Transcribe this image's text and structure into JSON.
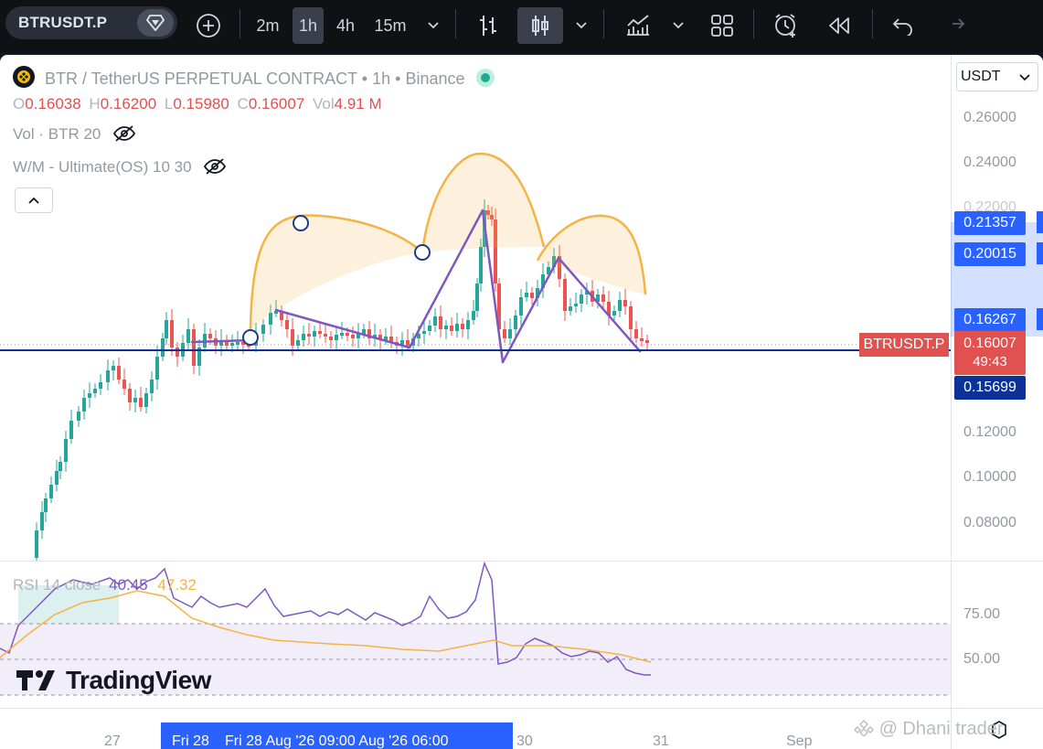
{
  "toolbar": {
    "symbol": "BTRUSDT.P",
    "intervals": [
      "2m",
      "1h",
      "4h",
      "15m"
    ],
    "active_interval": "1h"
  },
  "legend": {
    "title": "BTR / TetherUS PERPETUAL CONTRACT",
    "sep1": "•",
    "interval": "1h",
    "sep2": "•",
    "exchange": "Binance",
    "open_key": "O",
    "open": "0.16038",
    "high_key": "H",
    "high": "0.16200",
    "low_key": "L",
    "low": "0.15980",
    "close_key": "C",
    "close": "0.16007",
    "vol_key": "Vol",
    "vol": "4.91 M",
    "indicator_vol": "Vol · BTR 20",
    "indicator_wm": "W/M - Ultimate(OS) 10 30"
  },
  "currency": "USDT",
  "price_ticks": [
    "0.26000",
    "0.24000",
    "0.22000",
    "0.12000",
    "0.10000",
    "0.08000"
  ],
  "price_labels": [
    {
      "value": "0.21357",
      "color": "#2962ff"
    },
    {
      "value": "0.20015",
      "color": "#2962ff"
    },
    {
      "value": "0.16267",
      "color": "#2962ff"
    },
    {
      "value": "0.16007",
      "color": "#e0514f"
    },
    {
      "value": "0.15699",
      "color": "#0c3299"
    }
  ],
  "countdown": "49:43",
  "symbol_tag": "BTRUSDT.P",
  "rsi": {
    "label": "RSI 14 close",
    "value": "40.45",
    "ma": "47.32",
    "ticks": [
      "75.00",
      "50.00"
    ]
  },
  "time_axis": {
    "labels": [
      "27",
      "30",
      "31",
      "Sep"
    ],
    "highlight_left": "Fri 28",
    "highlight_right": "Fri 28 Aug '26   09:00   Aug '26   06:00"
  },
  "branding": {
    "logo_text": "TradingView",
    "watermark": "@ Dhani trader"
  },
  "colors": {
    "up": "#26a69a",
    "down": "#ef5350",
    "accent": "#2962ff",
    "pattern": "#f4b342",
    "trend": "#7e57c2"
  }
}
